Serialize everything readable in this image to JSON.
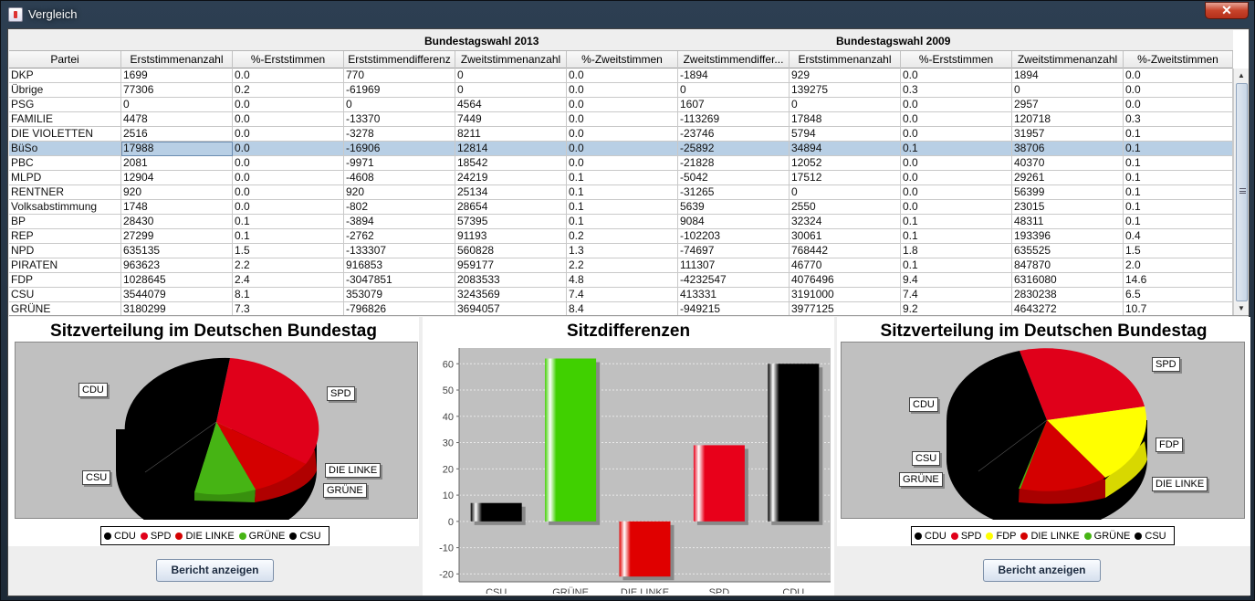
{
  "window": {
    "title": "Vergleich",
    "close_label": "✕"
  },
  "table": {
    "group_headers": [
      "Bundestagswahl 2013",
      "Bundestagswahl 2009"
    ],
    "columns": [
      "Partei",
      "Erststimmenanzahl",
      "%-Erststimmen",
      "Erststimmendifferenz",
      "Zweitstimmenanzahl",
      "%-Zweitstimmen",
      "Zweitstimmendiffer...",
      "Erststimmenanzahl",
      "%-Erststimmen",
      "Zweitstimmenanzahl",
      "%-Zweitstimmen"
    ],
    "rows": [
      [
        "DKP",
        "1699",
        "0.0",
        "770",
        "0",
        "0.0",
        "-1894",
        "929",
        "0.0",
        "1894",
        "0.0"
      ],
      [
        "Übrige",
        "77306",
        "0.2",
        "-61969",
        "0",
        "0.0",
        "0",
        "139275",
        "0.3",
        "0",
        "0.0"
      ],
      [
        "PSG",
        "0",
        "0.0",
        "0",
        "4564",
        "0.0",
        "1607",
        "0",
        "0.0",
        "2957",
        "0.0"
      ],
      [
        "FAMILIE",
        "4478",
        "0.0",
        "-13370",
        "7449",
        "0.0",
        "-113269",
        "17848",
        "0.0",
        "120718",
        "0.3"
      ],
      [
        "DIE VIOLETTEN",
        "2516",
        "0.0",
        "-3278",
        "8211",
        "0.0",
        "-23746",
        "5794",
        "0.0",
        "31957",
        "0.1"
      ],
      [
        "BüSo",
        "17988",
        "0.0",
        "-16906",
        "12814",
        "0.0",
        "-25892",
        "34894",
        "0.1",
        "38706",
        "0.1"
      ],
      [
        "PBC",
        "2081",
        "0.0",
        "-9971",
        "18542",
        "0.0",
        "-21828",
        "12052",
        "0.0",
        "40370",
        "0.1"
      ],
      [
        "MLPD",
        "12904",
        "0.0",
        "-4608",
        "24219",
        "0.1",
        "-5042",
        "17512",
        "0.0",
        "29261",
        "0.1"
      ],
      [
        "RENTNER",
        "920",
        "0.0",
        "920",
        "25134",
        "0.1",
        "-31265",
        "0",
        "0.0",
        "56399",
        "0.1"
      ],
      [
        "Volksabstimmung",
        "1748",
        "0.0",
        "-802",
        "28654",
        "0.1",
        "5639",
        "2550",
        "0.0",
        "23015",
        "0.1"
      ],
      [
        "BP",
        "28430",
        "0.1",
        "-3894",
        "57395",
        "0.1",
        "9084",
        "32324",
        "0.1",
        "48311",
        "0.1"
      ],
      [
        "REP",
        "27299",
        "0.1",
        "-2762",
        "91193",
        "0.2",
        "-102203",
        "30061",
        "0.1",
        "193396",
        "0.4"
      ],
      [
        "NPD",
        "635135",
        "1.5",
        "-133307",
        "560828",
        "1.3",
        "-74697",
        "768442",
        "1.8",
        "635525",
        "1.5"
      ],
      [
        "PIRATEN",
        "963623",
        "2.2",
        "916853",
        "959177",
        "2.2",
        "111307",
        "46770",
        "0.1",
        "847870",
        "2.0"
      ],
      [
        "FDP",
        "1028645",
        "2.4",
        "-3047851",
        "2083533",
        "4.8",
        "-4232547",
        "4076496",
        "9.4",
        "6316080",
        "14.6"
      ],
      [
        "CSU",
        "3544079",
        "8.1",
        "353079",
        "3243569",
        "7.4",
        "413331",
        "3191000",
        "7.4",
        "2830238",
        "6.5"
      ],
      [
        "GRÜNE",
        "3180299",
        "7.3",
        "-796826",
        "3694057",
        "8.4",
        "-949215",
        "3977125",
        "9.2",
        "4643272",
        "10.7"
      ]
    ],
    "selected_row": 5
  },
  "left_chart": {
    "title": "Sitzverteilung im Deutschen Bundestag",
    "labels": {
      "cdu": "CDU",
      "spd": "SPD",
      "linke": "DIE LINKE",
      "gruene": "GRÜNE",
      "csu": "CSU"
    },
    "legend": [
      {
        "name": "CDU",
        "color": "#000000"
      },
      {
        "name": "SPD",
        "color": "#e0001a"
      },
      {
        "name": "DIE LINKE",
        "color": "#d40000"
      },
      {
        "name": "GRÜNE",
        "color": "#46b414"
      },
      {
        "name": "CSU",
        "color": "#000000"
      }
    ],
    "button": "Bericht anzeigen"
  },
  "middle_chart": {
    "title": "Sitzdifferenzen",
    "ticks": [
      "60",
      "50",
      "40",
      "30",
      "20",
      "10",
      "0",
      "-10",
      "-20"
    ],
    "chart_data": {
      "type": "bar",
      "categories": [
        "CSU",
        "GRÜNE",
        "DIE LINKE",
        "SPD",
        "CDU"
      ],
      "values": [
        7,
        62,
        -21,
        29,
        60
      ],
      "colors": [
        "#000000",
        "#40d000",
        "#e00000",
        "#e8001a",
        "#000000"
      ],
      "ylim": [
        -23,
        66
      ]
    }
  },
  "right_chart": {
    "title": "Sitzverteilung im Deutschen Bundestag",
    "labels": {
      "spd": "SPD",
      "cdu": "CDU",
      "fdp": "FDP",
      "csu": "CSU",
      "gruene": "GRÜNE",
      "linke": "DIE LINKE"
    },
    "legend": [
      {
        "name": "CDU",
        "color": "#000000"
      },
      {
        "name": "SPD",
        "color": "#e0001a"
      },
      {
        "name": "FDP",
        "color": "#ffff00"
      },
      {
        "name": "DIE LINKE",
        "color": "#d40000"
      },
      {
        "name": "GRÜNE",
        "color": "#46b414"
      },
      {
        "name": "CSU",
        "color": "#000000"
      }
    ],
    "button": "Bericht anzeigen"
  }
}
